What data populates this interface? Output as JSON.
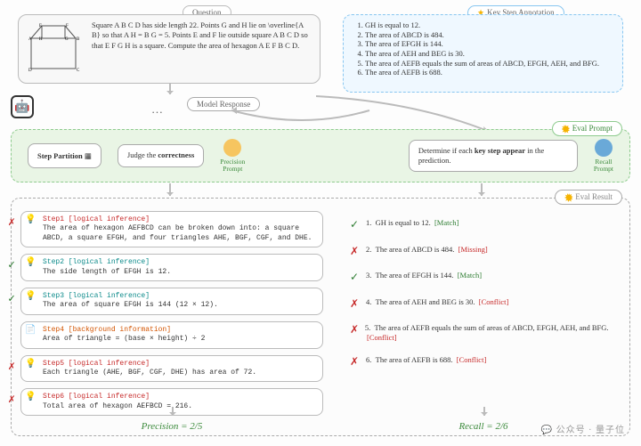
{
  "labels": {
    "question": "Question",
    "keystep": "Key Step Annotation",
    "model_response": "Model Response",
    "eval_prompt": "Eval Prompt",
    "eval_result": "Eval Result"
  },
  "question": {
    "text": "Square A B C D has side length 22. Points G and H lie on \\overline{A B} so that A H = B G = 5. Points E and F lie outside square A B C D so that E F G H is a square. Compute the area of hexagon A E F B C D."
  },
  "key_steps": [
    "GH is equal to 12.",
    "The area of ABCD is 484.",
    "The area of EFGH is 144.",
    "The area of AEH and BEG is 30.",
    "The area of AEFB equals the sum of areas of ABCD, EFGH, AEH, and BFG.",
    "The area of AEFB is 688."
  ],
  "green": {
    "step_partition": "Step Partition",
    "judge": "Judge the ",
    "judge_bold": "correctness",
    "precision_prompt": "Precision\nPrompt",
    "recall_text1": "Determine if each ",
    "recall_bold": "key step appear",
    "recall_text2": " in the prediction.",
    "recall_prompt": "Recall\nPrompt"
  },
  "steps": [
    {
      "mark": "✗",
      "markcls": "red",
      "hdr": "Step1 [logical inference]",
      "hdrcls": "red",
      "body": "The area of hexagon AEFBCD can be broken down into: a square ABCD, a square EFGH, and four triangles AHE, BGF, CGF, and DHE.",
      "icon": "💡"
    },
    {
      "mark": "✓",
      "markcls": "green",
      "hdr": "Step2 [logical inference]",
      "hdrcls": "teal",
      "body": "The side length of EFGH is 12.",
      "icon": "💡"
    },
    {
      "mark": "✓",
      "markcls": "green",
      "hdr": "Step3 [logical inference]",
      "hdrcls": "teal",
      "body": "The area of square EFGH is 144 (12 × 12).",
      "icon": "💡"
    },
    {
      "mark": "",
      "markcls": "",
      "hdr": "Step4 [background information]",
      "hdrcls": "orange",
      "body": "Area of triangle = (base × height) ÷ 2",
      "icon": "📄"
    },
    {
      "mark": "✗",
      "markcls": "red",
      "hdr": "Step5 [logical inference]",
      "hdrcls": "red",
      "body": "Each triangle (AHE, BGF, CGF, DHE) has area of 72.",
      "icon": "💡"
    },
    {
      "mark": "✗",
      "markcls": "red",
      "hdr": "Step6 [logical inference]",
      "hdrcls": "red",
      "body": "Total area of hexagon AEFBCD = 216.",
      "icon": "💡"
    }
  ],
  "recall": [
    {
      "mark": "✓",
      "markcls": "green",
      "text": "GH is equal to 12.",
      "tag": "[Match]",
      "tagcls": "green"
    },
    {
      "mark": "✗",
      "markcls": "red",
      "text": "The area of ABCD is 484.",
      "tag": "[Missing]",
      "tagcls": "red"
    },
    {
      "mark": "✓",
      "markcls": "green",
      "text": "The area of EFGH is 144.",
      "tag": "[Match]",
      "tagcls": "green"
    },
    {
      "mark": "✗",
      "markcls": "red",
      "text": "The area of AEH and BEG is 30.",
      "tag": "[Conflict]",
      "tagcls": "red"
    },
    {
      "mark": "✗",
      "markcls": "red",
      "text": "The area of AEFB equals the sum of areas of ABCD, EFGH, AEH, and BFG.",
      "tag": "[Conflict]",
      "tagcls": "red"
    },
    {
      "mark": "✗",
      "markcls": "red",
      "text": "The area of AEFB is 688.",
      "tag": "[Conflict]",
      "tagcls": "red"
    }
  ],
  "scores": {
    "precision": "Precision = 2/5",
    "recall": "Recall = 2/6"
  },
  "watermark": "公众号 · 量子位"
}
